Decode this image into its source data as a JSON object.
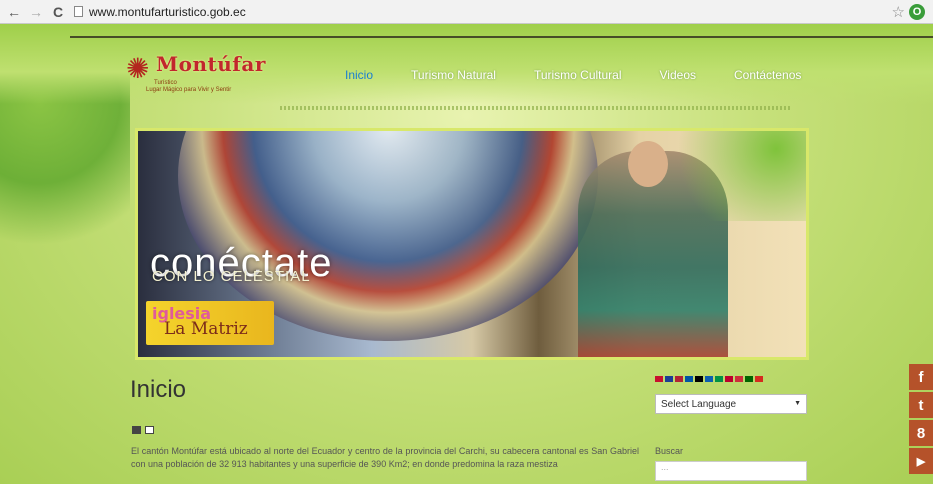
{
  "browser": {
    "back_icon": "←",
    "forward_icon": "→",
    "reload_icon": "C",
    "url": "www.montufarturistico.gob.ec",
    "star_icon": "☆"
  },
  "site": {
    "logo_title": "Montúfar",
    "logo_tag": "Turístico",
    "logo_slogan": "Lugar Mágico para Vivir y Sentir",
    "menu": [
      {
        "label": "Inicio",
        "active": true
      },
      {
        "label": "Turismo Natural",
        "active": false
      },
      {
        "label": "Turismo Cultural",
        "active": false
      },
      {
        "label": "Videos",
        "active": false
      },
      {
        "label": "Contáctenos",
        "active": false
      }
    ],
    "active_color": "#1a7fd0"
  },
  "banner": {
    "headline": "conéctate",
    "subheadline": "CON LO CELESTIAL",
    "tag_line1": "iglesia",
    "tag_line2": "La Matriz"
  },
  "content": {
    "title": "Inicio",
    "body": "El cantón Montúfar está ubicado al norte del Ecuador y centro de la provincia del Carchi, su cabecera cantonal es San Gabriel con una población de 32 913 habitantes y una superficie de 390 Km2; en donde predomina la raza mestiza"
  },
  "sidebar": {
    "language_select": "Select Language",
    "search_label": "Buscar",
    "search_placeholder": "..."
  },
  "social": [
    {
      "icon": "facebook-icon",
      "glyph": "f",
      "color": "#b5522a"
    },
    {
      "icon": "twitter-icon",
      "glyph": "t",
      "color": "#b5522a"
    },
    {
      "icon": "google-plus-icon",
      "glyph": "8",
      "color": "#b5522a"
    },
    {
      "icon": "youtube-icon",
      "glyph": "▶",
      "color": "#b5522a"
    }
  ]
}
